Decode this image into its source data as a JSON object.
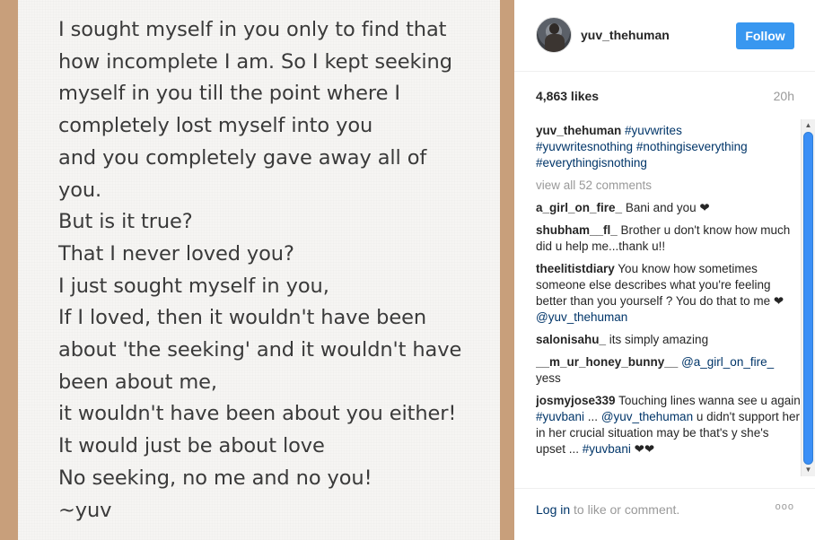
{
  "poem": {
    "lines": [
      "I sought myself in you only to find that",
      "how incomplete I am. So I kept seeking",
      "myself in you till the point where I",
      "completely lost myself into you",
      "and you completely gave away all of",
      "you.",
      "But is it true?",
      "That I never loved you?",
      "I just sought myself in you,",
      "If I loved, then it wouldn't have been",
      "about 'the seeking' and it wouldn't have",
      "been about me,",
      "it wouldn't have been about you either!",
      "It would just be about love",
      "No seeking, no me and no you!",
      "~yuv"
    ]
  },
  "header": {
    "username": "yuv_thehuman",
    "follow_label": "Follow"
  },
  "stats": {
    "likes": "4,863 likes",
    "time": "20h"
  },
  "caption": {
    "user": "yuv_thehuman",
    "tags": [
      "#yuvwrites",
      "#yuvwritesnothing",
      "#nothingiseverything",
      "#everythingisnothing"
    ]
  },
  "view_all": "view all 52 comments",
  "comments": [
    {
      "user": "a_girl_on_fire_",
      "parts": [
        {
          "t": "Bani and you ❤"
        }
      ]
    },
    {
      "user": "shubham__fl_",
      "parts": [
        {
          "t": "Brother u don't know how much did u help me...thank u!!"
        }
      ]
    },
    {
      "user": "theelitistdiary",
      "parts": [
        {
          "t": "You know how sometimes someone else describes what you're feeling better than you yourself ? You do that to me ❤ "
        },
        {
          "t": "@yuv_thehuman",
          "link": true
        }
      ]
    },
    {
      "user": "salonisahu_",
      "parts": [
        {
          "t": "its simply amazing"
        }
      ]
    },
    {
      "user": "__m_ur_honey_bunny__",
      "parts": [
        {
          "t": "@a_girl_on_fire_",
          "link": true
        },
        {
          "t": " yess"
        }
      ]
    },
    {
      "user": "josmyjose339",
      "parts": [
        {
          "t": "Touching lines  wanna see u again "
        },
        {
          "t": "#yuvbani",
          "link": true
        },
        {
          "t": " ... "
        },
        {
          "t": "@yuv_thehuman",
          "link": true
        },
        {
          "t": " u didn't support her in her crucial situation may be that's y she's upset ... "
        },
        {
          "t": "#yuvbani",
          "link": true
        },
        {
          "t": " ❤❤"
        }
      ]
    }
  ],
  "footer": {
    "login": "Log in",
    "rest": " to like or comment.",
    "more": "ooo"
  },
  "colors": {
    "follow_button": "#3897f0",
    "link": "#003569",
    "photo_border": "#c89f7b"
  }
}
